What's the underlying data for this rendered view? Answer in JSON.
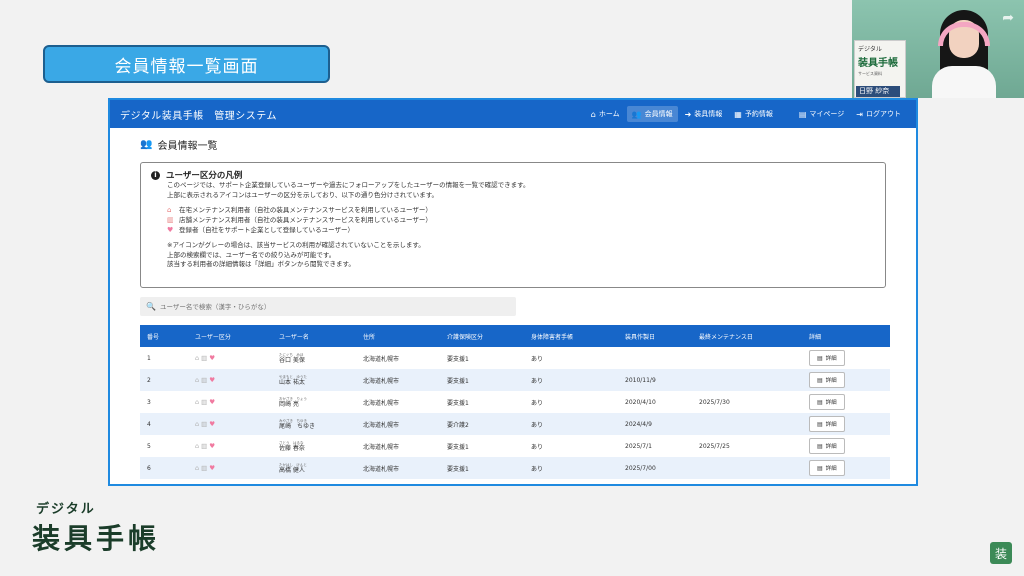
{
  "slide": {
    "title": "会員情報一覧画面"
  },
  "webcam": {
    "board_line1": "デジタル",
    "board_line2": "装具手帳",
    "board_line3": "サービス資料",
    "nameplate": "日野 紗奈"
  },
  "navbar": {
    "brand": "デジタル装具手帳　管理システム",
    "items": [
      {
        "label": "ホーム",
        "icon": "home-icon",
        "glyph": "⌂",
        "active": false
      },
      {
        "label": "会員情報",
        "icon": "users-icon",
        "glyph": "👥",
        "active": true
      },
      {
        "label": "装具情報",
        "icon": "arrow-icon",
        "glyph": "➜",
        "active": false
      },
      {
        "label": "予約情報",
        "icon": "calendar-icon",
        "glyph": "▦",
        "active": false
      }
    ],
    "right_items": [
      {
        "label": "マイページ",
        "icon": "id-card-icon",
        "glyph": "▤"
      },
      {
        "label": "ログアウト",
        "icon": "logout-icon",
        "glyph": "⇥"
      }
    ]
  },
  "page": {
    "title": "会員情報一覧"
  },
  "legend": {
    "title": "ユーザー区分の凡例",
    "intro1": "このページでは、サポート企業登録しているユーザーや過去にフォローアップをしたユーザーの情報を一覧で確認できます。",
    "intro2": "上部に表示されるアイコンはユーザーの区分を示しており、以下の通り色分けされています。",
    "items": [
      {
        "glyph": "⌂",
        "color": "#e77a7a",
        "text": "在宅メンテナンス利用者（自社の装具メンテナンスサービスを利用しているユーザー）"
      },
      {
        "glyph": "▥",
        "color": "#e77a7a",
        "text": "店舗メンテナンス利用者（自社の装具メンテナンスサービスを利用しているユーザー）"
      },
      {
        "glyph": "♥",
        "color": "#f07aa0",
        "text": "登録者（自社をサポート企業として登録しているユーザー）"
      }
    ],
    "note1": "※アイコンがグレーの場合は、該当サービスの利用が確認されていないことを示します。",
    "note2": "上部の検索欄では、ユーザー名での絞り込みが可能です。",
    "note3": "該当する利用者の詳細情報は「詳細」ボタンから閲覧できます。"
  },
  "search": {
    "placeholder": "ユーザー名で検索（漢字・ひらがな）"
  },
  "table": {
    "headers": [
      "番号",
      "ユーザー区分",
      "ユーザー名",
      "住所",
      "介護保険区分",
      "身体障害者手帳",
      "装具作製日",
      "最終メンテナンス日",
      "詳細"
    ],
    "detail_label": "詳細",
    "rows": [
      {
        "no": "1",
        "kana": "たにぐち　みほ",
        "name": "谷口 美保",
        "address": "北海道札幌市",
        "care": "要支援1",
        "cert": "あり",
        "made": "",
        "maint": ""
      },
      {
        "no": "2",
        "kana": "やまもと　ゆうた",
        "name": "山本 祐太",
        "address": "北海道札幌市",
        "care": "要支援1",
        "cert": "あり",
        "made": "2010/11/9",
        "maint": ""
      },
      {
        "no": "3",
        "kana": "おかざき　りょう",
        "name": "岡崎 亮",
        "address": "北海道札幌市",
        "care": "要支援1",
        "cert": "あり",
        "made": "2020/4/10",
        "maint": "2025/7/30"
      },
      {
        "no": "4",
        "kana": "みやざき　ちゆき",
        "name": "尾崎　ちゆき",
        "address": "北海道札幌市",
        "care": "要介護2",
        "cert": "あり",
        "made": "2024/4/9",
        "maint": ""
      },
      {
        "no": "5",
        "kana": "さとう　はるな",
        "name": "佐藤 春奈",
        "address": "北海道札幌市",
        "care": "要支援1",
        "cert": "あり",
        "made": "2025/7/1",
        "maint": "2025/7/25"
      },
      {
        "no": "6",
        "kana": "たかはし　けんと",
        "name": "高橋 健人",
        "address": "北海道札幌市",
        "care": "要支援1",
        "cert": "あり",
        "made": "2025/7/00",
        "maint": ""
      }
    ]
  },
  "footer": {
    "logo_small": "デジタル",
    "logo_big": "装具手帳",
    "badge": "装"
  }
}
